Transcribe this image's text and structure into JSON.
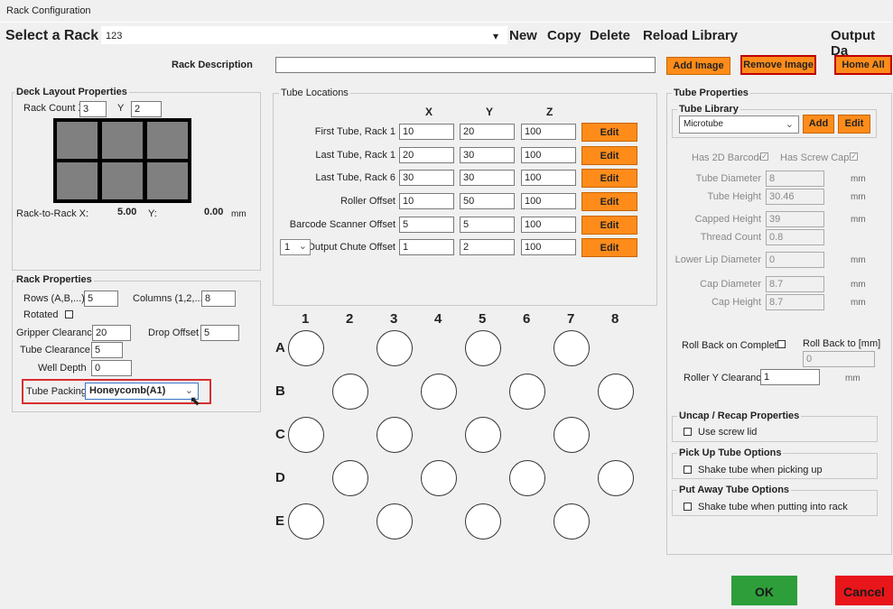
{
  "window": {
    "title": "Rack Configuration"
  },
  "rack_select": {
    "label": "Select a Rack",
    "value": "123"
  },
  "menu": {
    "new": "New",
    "copy": "Copy",
    "delete": "Delete",
    "reload": "Reload Library",
    "output": "Output Da"
  },
  "rack_description": {
    "label": "Rack Description",
    "value": ""
  },
  "image_buttons": {
    "add": "Add Image",
    "remove": "Remove Image",
    "home_all": "Home All"
  },
  "deck": {
    "group_label": "Deck Layout Properties",
    "rack_count_x_label": "Rack Count X",
    "rack_count_x": "3",
    "y_label": "Y",
    "rack_count_y": "2",
    "rack_to_rack_label": "Rack-to-Rack X:",
    "rack_to_rack_x": "5.00",
    "y2_label": "Y:",
    "rack_to_rack_y": "0.00",
    "unit": "mm"
  },
  "rack_props": {
    "group_label": "Rack Properties",
    "rows_label": "Rows (A,B,...)",
    "rows": "5",
    "cols_label": "Columns (1,2,...)",
    "cols": "8",
    "rotated_label": "Rotated",
    "gripper_label": "Gripper Clearance",
    "gripper": "20",
    "drop_label": "Drop Offset",
    "drop": "5",
    "tube_clear_label": "Tube Clearance",
    "tube_clear": "5",
    "well_depth_label": "Well Depth",
    "well_depth": "0",
    "packing_label": "Tube Packing",
    "packing": "Honeycomb(A1)"
  },
  "tube_locations": {
    "group_label": "Tube Locations",
    "headers": {
      "x": "X",
      "y": "Y",
      "z": "Z"
    },
    "edit": "Edit",
    "rows": [
      {
        "label": "First Tube, Rack 1",
        "x": "10",
        "y": "20",
        "z": "100"
      },
      {
        "label": "Last Tube, Rack 1",
        "x": "20",
        "y": "30",
        "z": "100"
      },
      {
        "label": "Last Tube, Rack 6",
        "x": "30",
        "y": "30",
        "z": "100"
      },
      {
        "label": "Roller Offset",
        "x": "10",
        "y": "50",
        "z": "100"
      },
      {
        "label": "Barcode Scanner Offset",
        "x": "5",
        "y": "5",
        "z": "100"
      },
      {
        "label": "Output Chute Offset",
        "x": "1",
        "y": "2",
        "z": "100"
      }
    ],
    "chute_select": "1"
  },
  "grid": {
    "columns": [
      "1",
      "2",
      "3",
      "4",
      "5",
      "6",
      "7",
      "8"
    ],
    "rows": [
      "A",
      "B",
      "C",
      "D",
      "E"
    ]
  },
  "tube_props": {
    "group_label": "Tube Properties",
    "library_label": "Tube Library",
    "library_value": "Microtube",
    "add": "Add",
    "edit": "Edit",
    "has_2d_label": "Has 2D Barcode",
    "has_screw_label": "Has Screw Cap",
    "diameter_label": "Tube Diameter",
    "diameter": "8",
    "height_label": "Tube Height",
    "height": "30.46",
    "capped_label": "Capped Height",
    "capped": "39",
    "thread_label": "Thread Count",
    "thread": "0.8",
    "lower_lip_label": "Lower Lip Diameter",
    "lower_lip": "0",
    "cap_diam_label": "Cap Diameter",
    "cap_diam": "8.7",
    "cap_height_label": "Cap Height",
    "cap_height": "8.7",
    "unit": "mm",
    "rollback_complete_label": "Roll Back on Complete",
    "rollback_to_label": "Roll Back to [mm]",
    "rollback_to": "0",
    "roller_y_label": "Roller Y Clearance",
    "roller_y": "1"
  },
  "uncap": {
    "group_label": "Uncap / Recap Properties",
    "option": "Use screw lid"
  },
  "pickup": {
    "group_label": "Pick Up Tube Options",
    "option": "Shake tube when picking up"
  },
  "putaway": {
    "group_label": "Put Away Tube Options",
    "option": "Shake tube when putting into rack"
  },
  "footer": {
    "ok": "OK",
    "cancel": "Cancel",
    "ok_color": "#2e9e3a",
    "cancel_color": "#e8161a"
  }
}
